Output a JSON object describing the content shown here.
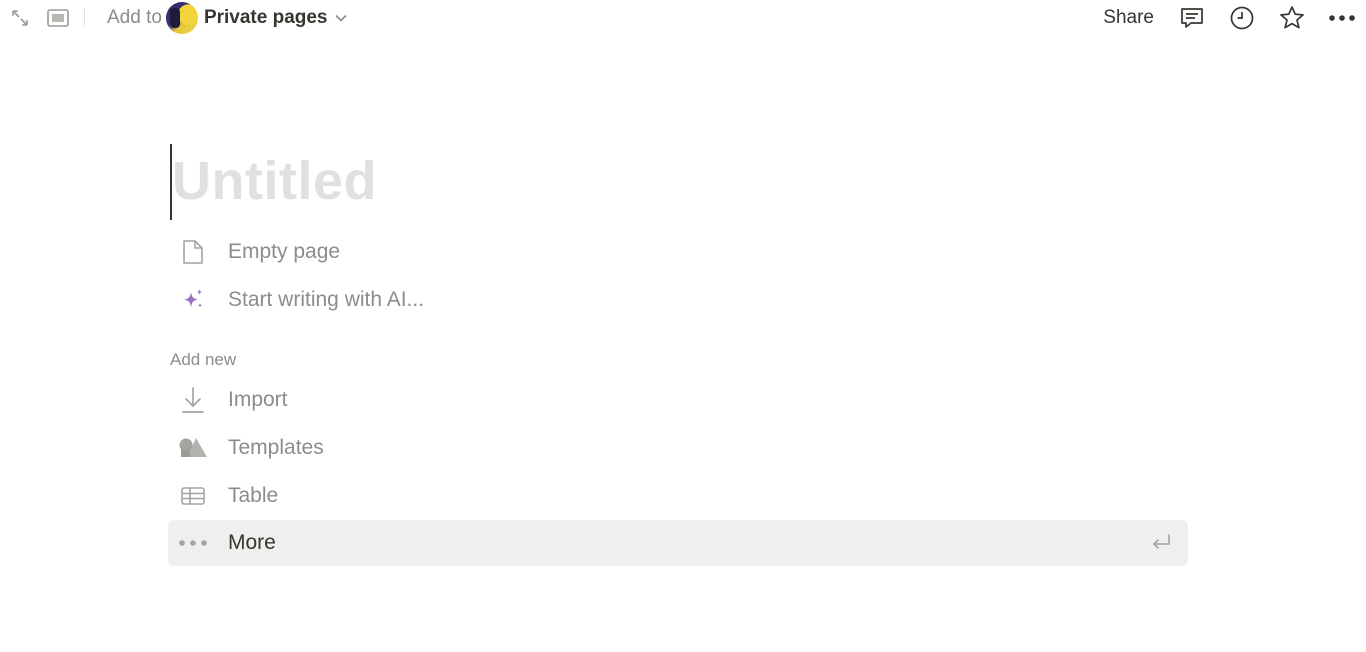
{
  "topbar": {
    "add_to_label": "Add to",
    "workspace_name": "Private pages",
    "share_label": "Share",
    "icons": [
      "expand-icon",
      "sidebar-toggle-icon",
      "comment-icon",
      "clock-icon",
      "star-icon",
      "more-icon"
    ]
  },
  "page": {
    "title_placeholder": "Untitled"
  },
  "options": [
    {
      "label": "Empty page",
      "icon": "page-icon"
    },
    {
      "label": "Start writing with AI...",
      "icon": "sparkle-icon"
    }
  ],
  "add_new": {
    "label": "Add new",
    "items": [
      {
        "label": "Import",
        "icon": "download-icon"
      },
      {
        "label": "Templates",
        "icon": "shapes-icon"
      },
      {
        "label": "Table",
        "icon": "table-icon"
      },
      {
        "label": "More",
        "icon": "more-dots-icon",
        "highlighted": true
      }
    ]
  },
  "colors": {
    "accent_ai": "#9b6fc4",
    "highlight_bg": "#efefee",
    "placeholder_text": "#e0e0de"
  }
}
